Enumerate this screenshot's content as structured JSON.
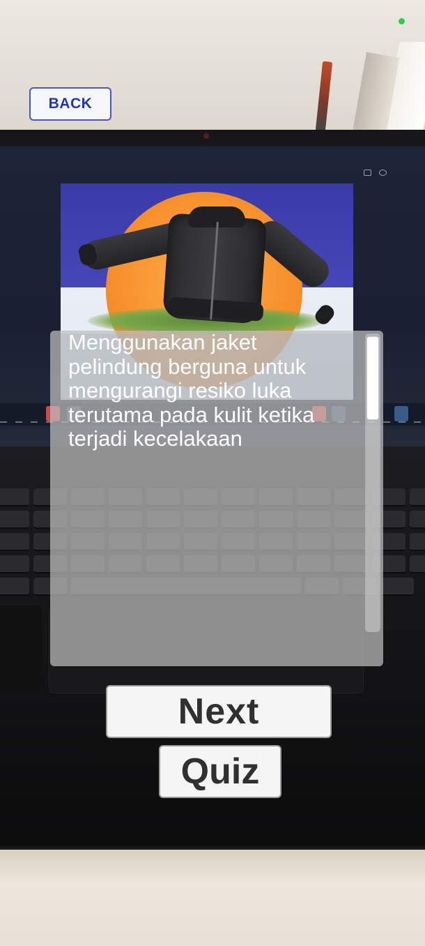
{
  "navigation": {
    "back_label": "BACK"
  },
  "info_panel": {
    "description": "Menggunakan jaket pelindung berguna untuk mengurangi resiko luka terutama pada kulit ketika terjadi kecelakaan"
  },
  "actions": {
    "next_label": "Next",
    "quiz_label": "Quiz"
  },
  "colors": {
    "back_text": "#2035b8",
    "button_text": "#303030",
    "panel_background": "rgba(190,190,190,0.72)",
    "status_indicator": "#2ecc55"
  },
  "icons": {
    "status": "green-dot-icon",
    "ar_model": "jacket-3d-model"
  }
}
